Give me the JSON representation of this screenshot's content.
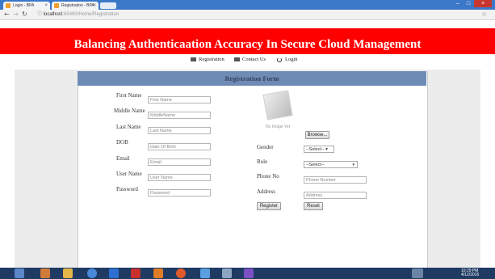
{
  "browser": {
    "tabs": [
      {
        "label": "Login - BPA"
      },
      {
        "label": "Registration - BPA"
      }
    ],
    "url_host": "localhost",
    "url_rest": ":65490/Home/Registration"
  },
  "header": {
    "title": "Balancing Authenticaation Accuracy In Secure Cloud Management"
  },
  "nav": {
    "registration": "Registration",
    "contact": "Contact Us",
    "login": "Login"
  },
  "form": {
    "heading": "Registration Form",
    "first_name": {
      "label": "First Name",
      "placeholder": "First Name"
    },
    "middle_name": {
      "label": "Middle Name",
      "placeholder": "MiddleName"
    },
    "last_name": {
      "label": "Last Name",
      "placeholder": "Last Name"
    },
    "dob": {
      "label": "DOB",
      "placeholder": "Date Of Birth"
    },
    "email": {
      "label": "Email",
      "placeholder": "Email"
    },
    "user_name": {
      "label": "User Name",
      "placeholder": "User Name"
    },
    "password": {
      "label": "Password",
      "placeholder": "Password"
    },
    "photo_caption": "No Image Yet",
    "browse": "Browse...",
    "gender": {
      "label": "Gender",
      "value": "--Select-- ▾"
    },
    "role": {
      "label": "Role",
      "value": "--Select--"
    },
    "phone": {
      "label": "Phone No",
      "placeholder": "Phone Number"
    },
    "address": {
      "label": "Address",
      "placeholder": "Address"
    },
    "register": "Register",
    "reset": "Reset"
  },
  "taskbar": {
    "time": "10:29 PM",
    "date": "4/12/2016"
  },
  "colors": {
    "brand_red": "#ff0000",
    "form_header": "#6e8bb5",
    "taskbar": "#1f3b63"
  }
}
